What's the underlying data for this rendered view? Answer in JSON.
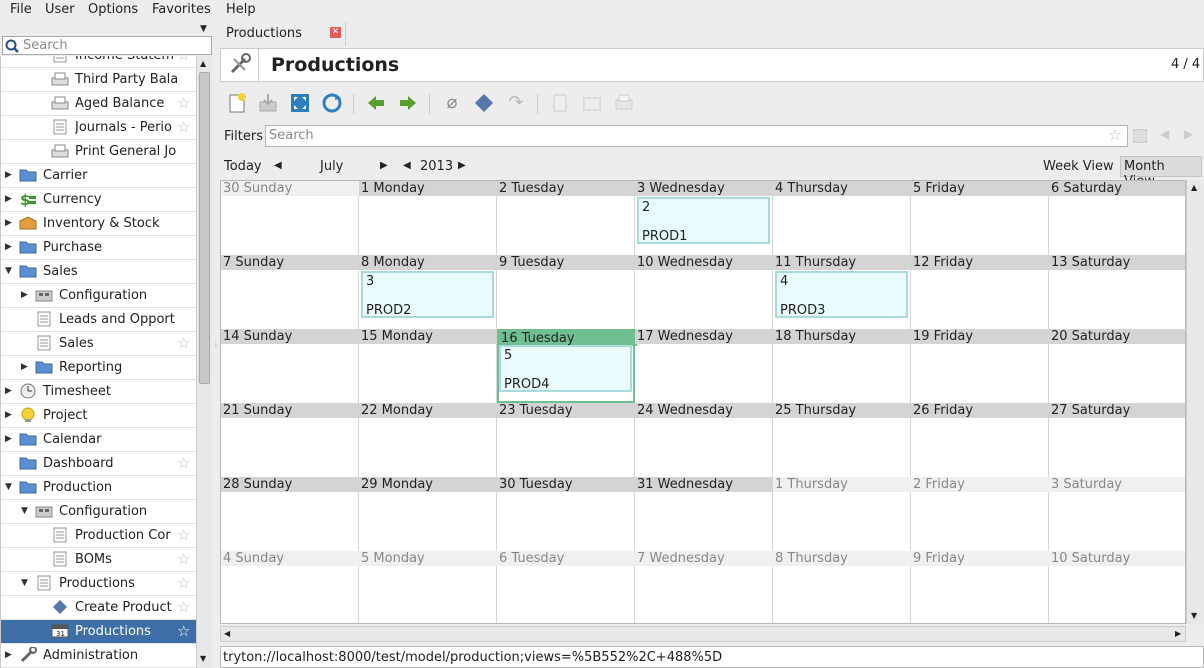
{
  "menu": {
    "file": "File",
    "user": "User",
    "options": "Options",
    "favorites": "Favorites",
    "help": "Help"
  },
  "sidebar": {
    "search_placeholder": "Search",
    "items": [
      {
        "label": "Income Statem",
        "kind": "leaf"
      },
      {
        "label": "Third Party Bala",
        "kind": "leaf"
      },
      {
        "label": "Aged Balance",
        "kind": "leaf"
      },
      {
        "label": "Journals - Perio",
        "kind": "leaf"
      },
      {
        "label": "Print General Jo",
        "kind": "leaf"
      },
      {
        "label": "Carrier",
        "kind": "folder"
      },
      {
        "label": "Currency",
        "kind": "folder"
      },
      {
        "label": "Inventory & Stock",
        "kind": "folder"
      },
      {
        "label": "Purchase",
        "kind": "folder"
      },
      {
        "label": "Sales",
        "kind": "folder"
      },
      {
        "label": "Configuration",
        "kind": "folder"
      },
      {
        "label": "Leads and Opport",
        "kind": "leaf"
      },
      {
        "label": "Sales",
        "kind": "leaf"
      },
      {
        "label": "Reporting",
        "kind": "folder"
      },
      {
        "label": "Timesheet",
        "kind": "folder"
      },
      {
        "label": "Project",
        "kind": "folder"
      },
      {
        "label": "Calendar",
        "kind": "folder"
      },
      {
        "label": "Dashboard",
        "kind": "leaf"
      },
      {
        "label": "Production",
        "kind": "folder"
      },
      {
        "label": "Configuration",
        "kind": "folder"
      },
      {
        "label": "Production Cor",
        "kind": "leaf"
      },
      {
        "label": "BOMs",
        "kind": "leaf"
      },
      {
        "label": "Productions",
        "kind": "leaf"
      },
      {
        "label": "Create Product",
        "kind": "leaf"
      },
      {
        "label": "Productions",
        "kind": "leaf",
        "selected": true
      },
      {
        "label": "Administration",
        "kind": "folder"
      }
    ]
  },
  "tab": {
    "label": "Productions"
  },
  "header": {
    "title": "Productions",
    "record_count": "4 / 4"
  },
  "filters": {
    "label": "Filters",
    "placeholder": "Search"
  },
  "nav": {
    "today": "Today",
    "month": "July",
    "year": "2013",
    "week_view": "Week View",
    "month_view": "Month View"
  },
  "calendar": {
    "weeks": [
      [
        "30 Sunday",
        "1 Monday",
        "2 Tuesday",
        "3 Wednesday",
        "4 Thursday",
        "5 Friday",
        "6 Saturday"
      ],
      [
        "7 Sunday",
        "8 Monday",
        "9 Tuesday",
        "10 Wednesday",
        "11 Thursday",
        "12 Friday",
        "13 Saturday"
      ],
      [
        "14 Sunday",
        "15 Monday",
        "16 Tuesday",
        "17 Wednesday",
        "18 Thursday",
        "19 Friday",
        "20 Saturday"
      ],
      [
        "21 Sunday",
        "22 Monday",
        "23 Tuesday",
        "24 Wednesday",
        "25 Thursday",
        "26 Friday",
        "27 Saturday"
      ],
      [
        "28 Sunday",
        "29 Monday",
        "30 Tuesday",
        "31 Wednesday",
        "1 Thursday",
        "2 Friday",
        "3 Saturday"
      ],
      [
        "4 Sunday",
        "5 Monday",
        "6 Tuesday",
        "7 Wednesday",
        "8 Thursday",
        "9 Friday",
        "10 Saturday"
      ]
    ],
    "events": [
      {
        "week": 0,
        "day": 3,
        "number": "2",
        "name": "PROD1"
      },
      {
        "week": 1,
        "day": 1,
        "number": "3",
        "name": "PROD2"
      },
      {
        "week": 1,
        "day": 4,
        "number": "4",
        "name": "PROD3"
      },
      {
        "week": 2,
        "day": 2,
        "number": "5",
        "name": "PROD4"
      }
    ],
    "today": {
      "week": 2,
      "day": 2
    }
  },
  "status": {
    "url": "tryton://localhost:8000/test/model/production;views=%5B552%2C+488%5D"
  },
  "colors": {
    "selection": "#3d6ea8",
    "today": "#6fbf92",
    "event_bg": "#e9fbfc",
    "event_border": "#a9dadf"
  }
}
